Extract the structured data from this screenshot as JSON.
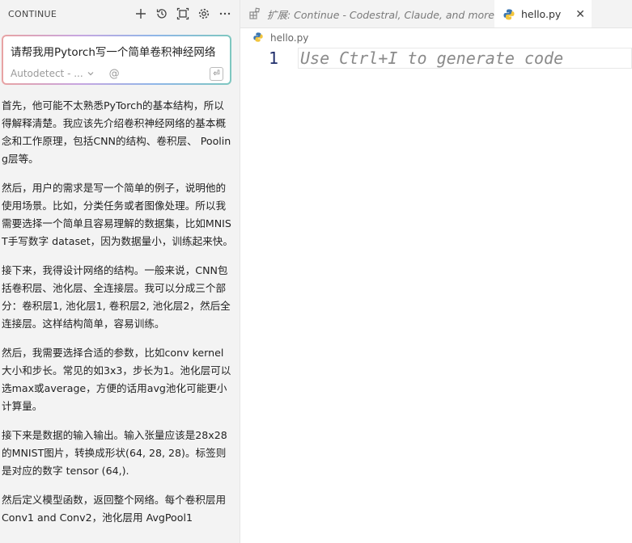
{
  "sidebar": {
    "title": "CONTINUE",
    "input": {
      "value": "请帮我用Pytorch写一个简单卷积神经网络",
      "model": "Autodetect - ...",
      "at_symbol": "@",
      "enter_symbol": "⏎"
    },
    "messages": [
      "首先，他可能不太熟悉PyTorch的基本结构，所以得解释清楚。我应该先介绍卷积神经网络的基本概念和工作原理，包括CNN的结构、卷积层、 Pooling层等。",
      "然后，用户的需求是写一个简单的例子，说明他的使用场景。比如，分类任务或者图像处理。所以我需要选择一个简单且容易理解的数据集，比如MNIST手写数字 dataset，因为数据量小，训练起来快。",
      "接下来，我得设计网络的结构。一般来说，CNN包括卷积层、池化层、全连接层。我可以分成三个部分：卷积层1, 池化层1, 卷积层2, 池化层2，然后全连接层。这样结构简单，容易训练。",
      "然后，我需要选择合适的参数，比如conv kernel大小和步长。常见的如3x3，步长为1。池化层可以选max或average，方便的话用avg池化可能更小计算量。",
      "接下来是数据的输入输出。输入张量应该是28x28的MNIST图片，转换成形状(64, 28, 28)。标签则是对应的数字 tensor (64,).",
      "然后定义模型函数，返回整个网络。每个卷积层用 Conv1 and Conv2，池化层用 AvgPool1"
    ]
  },
  "editor": {
    "tabs": [
      {
        "label": "扩展: Continue - Codestral, Claude, and more",
        "active": false
      },
      {
        "label": "hello.py",
        "active": true
      }
    ],
    "breadcrumb": "hello.py",
    "line_number": "1",
    "placeholder": "Use Ctrl+I to generate code"
  },
  "colors": {
    "accent_gradient": [
      "#e8a3a3",
      "#c8a6e0",
      "#8fb6e8",
      "#7ec7c0"
    ],
    "line_number": "#1f2e6b"
  }
}
